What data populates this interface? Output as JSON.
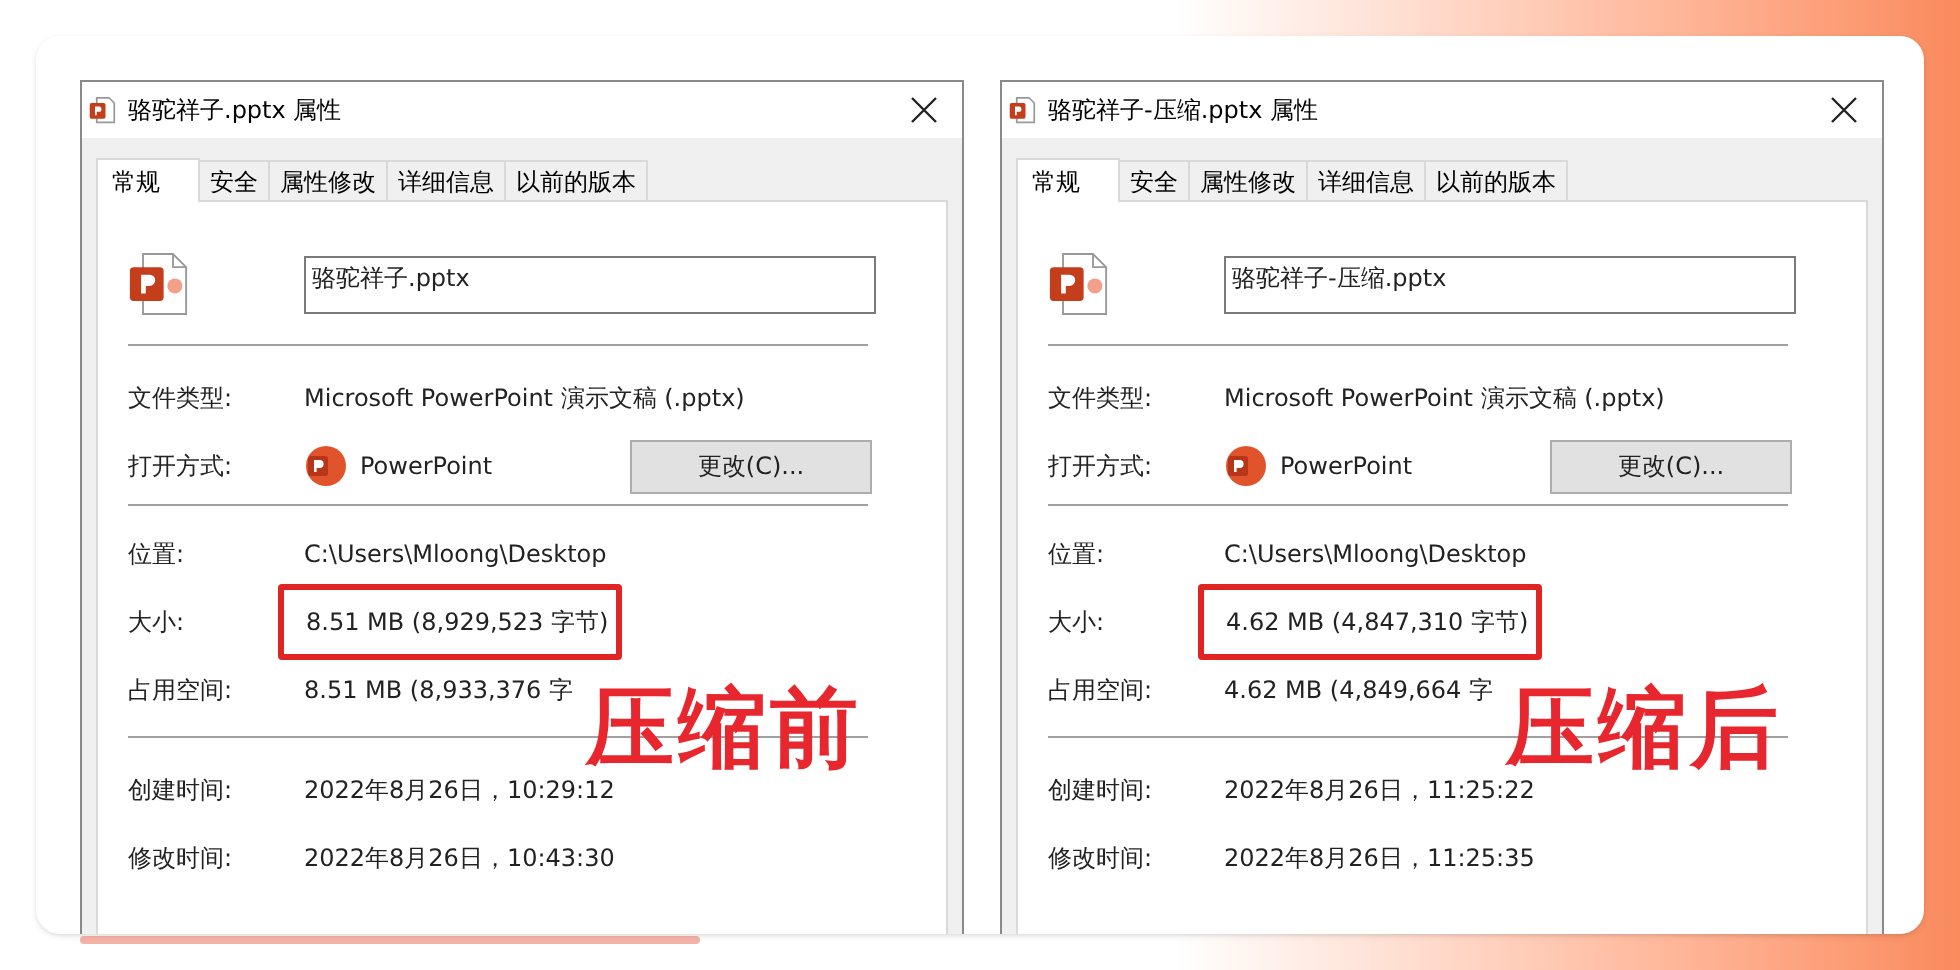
{
  "dialogs": [
    {
      "title": "骆驼祥子.pptx 属性",
      "tabs": [
        {
          "label": "常规",
          "selected": true
        },
        {
          "label": "安全",
          "selected": false
        },
        {
          "label": "属性修改",
          "selected": false
        },
        {
          "label": "详细信息",
          "selected": false
        },
        {
          "label": "以前的版本",
          "selected": false
        }
      ],
      "file_name": "骆驼祥子.pptx",
      "file_type": {
        "label": "文件类型:",
        "value": "Microsoft PowerPoint 演示文稿 (.pptx)"
      },
      "opens_with": {
        "label": "打开方式:",
        "app": "PowerPoint",
        "button": "更改(C)..."
      },
      "size_rows": [
        {
          "label": "位置:",
          "value": "C:\\Users\\Mloong\\Desktop",
          "highlighted": false
        },
        {
          "label": "大小:",
          "value": "8.51 MB (8,929,523 字节)",
          "highlighted": true
        },
        {
          "label": "占用空间:",
          "value": "8.51 MB (8,933,376 字",
          "highlighted": false
        }
      ],
      "time_rows": [
        {
          "label": "创建时间:",
          "value": "2022年8月26日，10:29:12"
        },
        {
          "label": "修改时间:",
          "value": "2022年8月26日，10:43:30"
        }
      ],
      "stamp": "压缩前"
    },
    {
      "title": "骆驼祥子-压缩.pptx 属性",
      "tabs": [
        {
          "label": "常规",
          "selected": true
        },
        {
          "label": "安全",
          "selected": false
        },
        {
          "label": "属性修改",
          "selected": false
        },
        {
          "label": "详细信息",
          "selected": false
        },
        {
          "label": "以前的版本",
          "selected": false
        }
      ],
      "file_name": "骆驼祥子-压缩.pptx",
      "file_type": {
        "label": "文件类型:",
        "value": "Microsoft PowerPoint 演示文稿 (.pptx)"
      },
      "opens_with": {
        "label": "打开方式:",
        "app": "PowerPoint",
        "button": "更改(C)..."
      },
      "size_rows": [
        {
          "label": "位置:",
          "value": "C:\\Users\\Mloong\\Desktop",
          "highlighted": false
        },
        {
          "label": "大小:",
          "value": "4.62 MB (4,847,310 字节)",
          "highlighted": true
        },
        {
          "label": "占用空间:",
          "value": "4.62 MB (4,849,664 字",
          "highlighted": false
        }
      ],
      "time_rows": [
        {
          "label": "创建时间:",
          "value": "2022年8月26日，11:25:22"
        },
        {
          "label": "修改时间:",
          "value": "2022年8月26日，11:25:35"
        }
      ],
      "stamp": "压缩后"
    }
  ]
}
